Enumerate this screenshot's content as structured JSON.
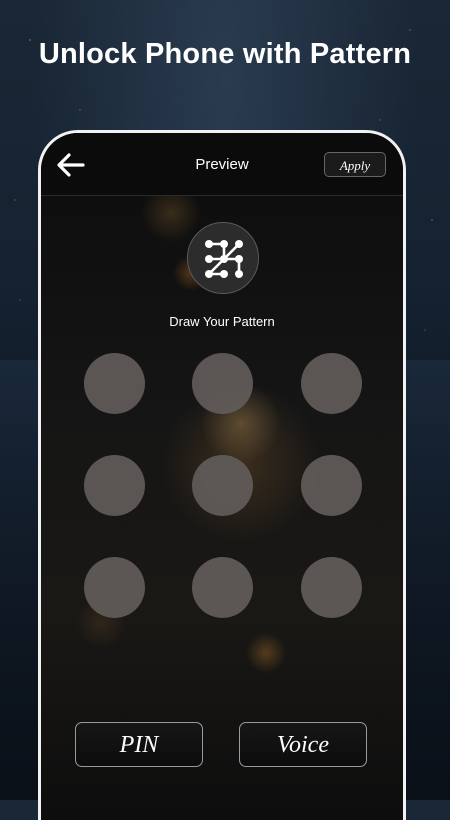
{
  "headline": "Unlock Phone with Pattern",
  "topbar": {
    "back_icon": "arrow-left-icon",
    "title": "Preview",
    "apply_label": "Apply"
  },
  "emblem": {
    "icon": "pattern-grid-icon"
  },
  "draw_label": "Draw Your Pattern",
  "grid": {
    "rows": 3,
    "cols": 3,
    "dot_color": "#625c5a"
  },
  "buttons": {
    "pin_label": "PIN",
    "voice_label": "Voice"
  }
}
